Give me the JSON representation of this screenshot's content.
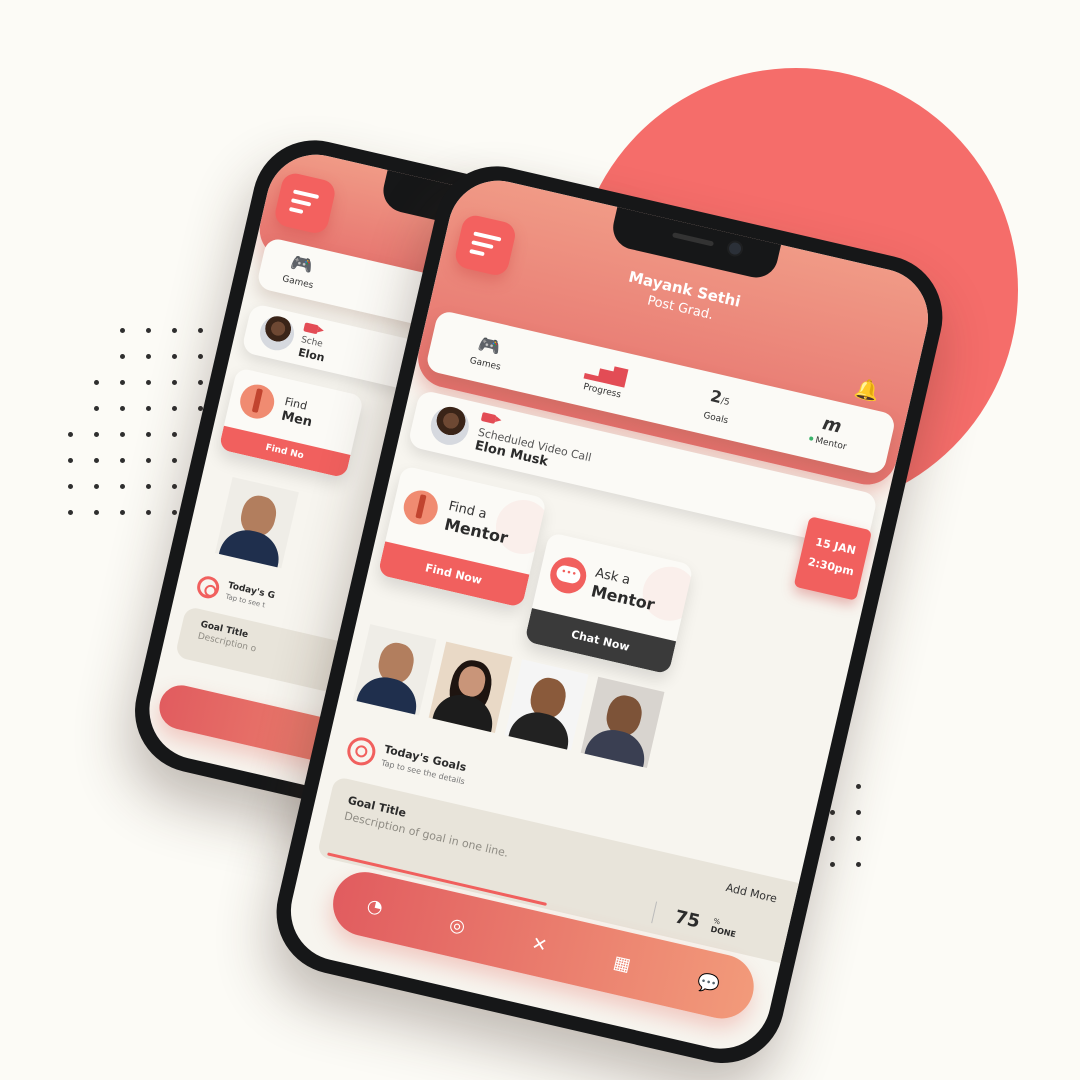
{
  "colors": {
    "accent": "#f1605e",
    "background": "#fcfbf6",
    "circle": "#f56d6a",
    "dark_button": "#3a3a3a"
  },
  "profile": {
    "name": "Mayank Sethi",
    "subtitle": "Post Grad."
  },
  "stats": {
    "games_label": "Games",
    "games_icon": "gamepad-icon",
    "progress_label": "Progress",
    "progress_icon": "bar-chart-icon",
    "goals_value": "2",
    "goals_total": "/5",
    "goals_label": "Goals",
    "mentor_glyph": "m",
    "mentor_label": "Mentor"
  },
  "call": {
    "label": "Scheduled Video Call",
    "name": "Elon Musk",
    "date": "15  JAN",
    "time": "2:30pm"
  },
  "find_card": {
    "line1": "Find a",
    "line2": "Mentor",
    "button": "Find Now"
  },
  "ask_card": {
    "line1": "Ask a",
    "line2": "Mentor",
    "button": "Chat Now"
  },
  "goals": {
    "title": "Today's Goals",
    "subtitle": "Tap to see the details",
    "goal_title": "Goal Title",
    "goal_desc": "Description of goal in one line.",
    "add_more": "Add More",
    "percent": "75",
    "percent_symbol": "%",
    "done": "DONE",
    "progress": 0.75
  },
  "back_phone": {
    "games": "Games",
    "call_short": "Sche",
    "name_short": "Elon",
    "find_short": "Find",
    "mentor_short": "Men",
    "findnow_short": "Find No",
    "goals_short": "Today's G",
    "goals_sub_short": "Tap to see t",
    "goal_title": "Goal Title",
    "goal_desc_short": "Description o"
  }
}
